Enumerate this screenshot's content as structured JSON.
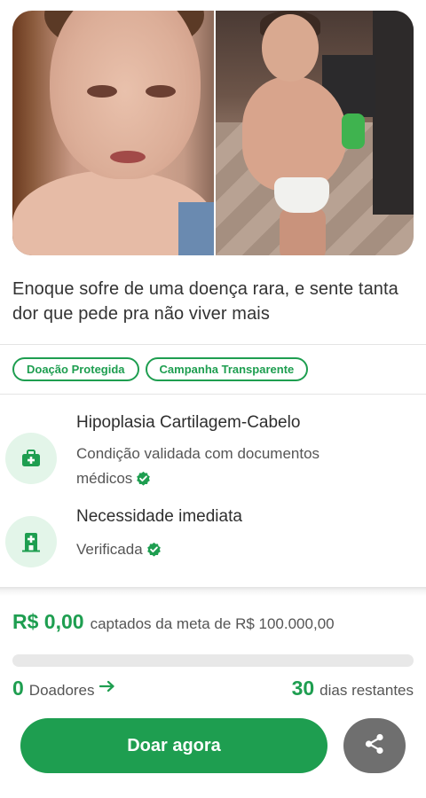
{
  "campaign": {
    "title": "Enoque sofre de uma doença rara, e sente tanta dor que pede pra não viver mais",
    "tags": [
      "Doação Protegida",
      "Campanha Transparente"
    ]
  },
  "features": [
    {
      "icon": "first-aid-kit-icon",
      "title": "Hipoplasia Cartilagem-Cabelo",
      "description": "Condição validada com documentos médicos",
      "verified": true
    },
    {
      "icon": "hospital-icon",
      "title": "Necessidade imediata",
      "description": "Verificada",
      "verified": true
    }
  ],
  "funding": {
    "raised": "R$ 0,00",
    "goal_text": "captados da meta de R$ 100.000,00",
    "progress_fraction": 0,
    "donors_count": "0",
    "donors_label": "Doadores",
    "days_count": "30",
    "days_label": "dias restantes"
  },
  "actions": {
    "donate_label": "Doar agora",
    "share_icon": "share-icon"
  },
  "colors": {
    "accent": "#1e9e50",
    "share_button": "#6f6f6f",
    "icon_circle": "#e3f5e9"
  }
}
